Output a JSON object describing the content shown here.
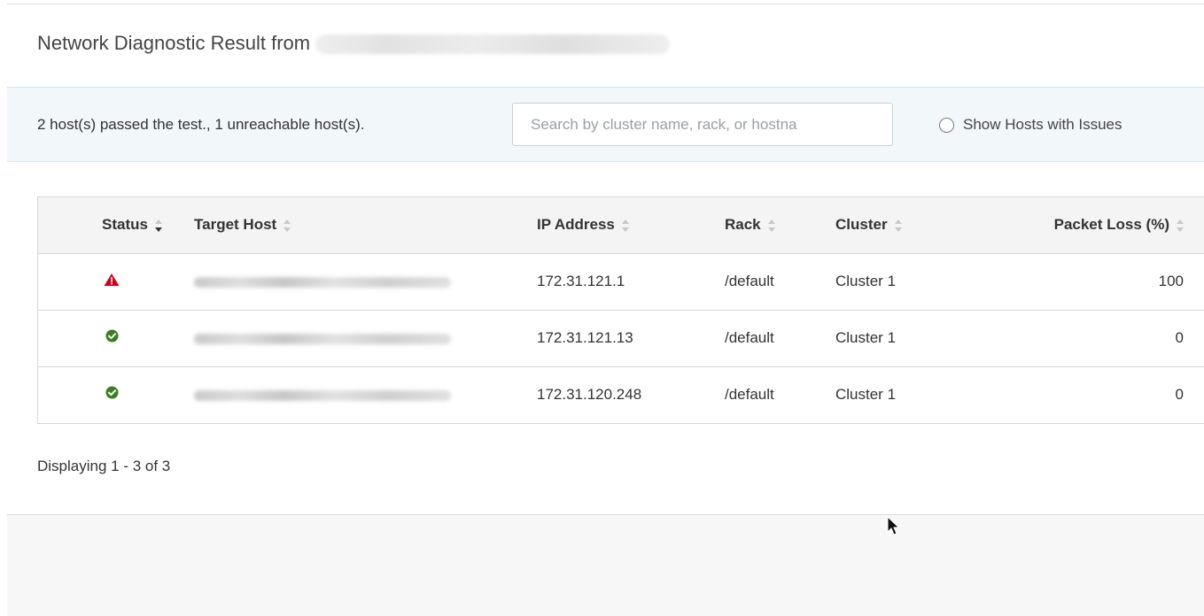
{
  "header": {
    "title": "Network Diagnostic Result from"
  },
  "summary": {
    "text": "2 host(s) passed the test., 1 unreachable host(s).",
    "search_placeholder": "Search by cluster name, rack, or hostna",
    "search_value": "",
    "issues_toggle_label": "Show Hosts with Issues"
  },
  "table": {
    "columns": {
      "status": "Status",
      "target_host": "Target Host",
      "ip_address": "IP Address",
      "rack": "Rack",
      "cluster": "Cluster",
      "packet_loss": "Packet Loss (%)"
    },
    "sort_column": "status",
    "rows": [
      {
        "status": "warning",
        "ip": "172.31.121.1",
        "rack": "/default",
        "cluster": "Cluster 1",
        "packet_loss": "100"
      },
      {
        "status": "ok",
        "ip": "172.31.121.13",
        "rack": "/default",
        "cluster": "Cluster 1",
        "packet_loss": "0"
      },
      {
        "status": "ok",
        "ip": "172.31.120.248",
        "rack": "/default",
        "cluster": "Cluster 1",
        "packet_loss": "0"
      }
    ]
  },
  "footer": {
    "pagination_text": "Displaying 1 - 3 of 3"
  },
  "colors": {
    "warning": "#d0021b",
    "ok": "#3a7d22",
    "summary_bg": "#f2f7fa",
    "header_row_bg": "#f4f4f4"
  },
  "icons": {
    "warning": "warning-triangle-icon",
    "ok": "check-circle-icon",
    "sort": "sort-icon",
    "cursor": "mouse-pointer-icon"
  }
}
